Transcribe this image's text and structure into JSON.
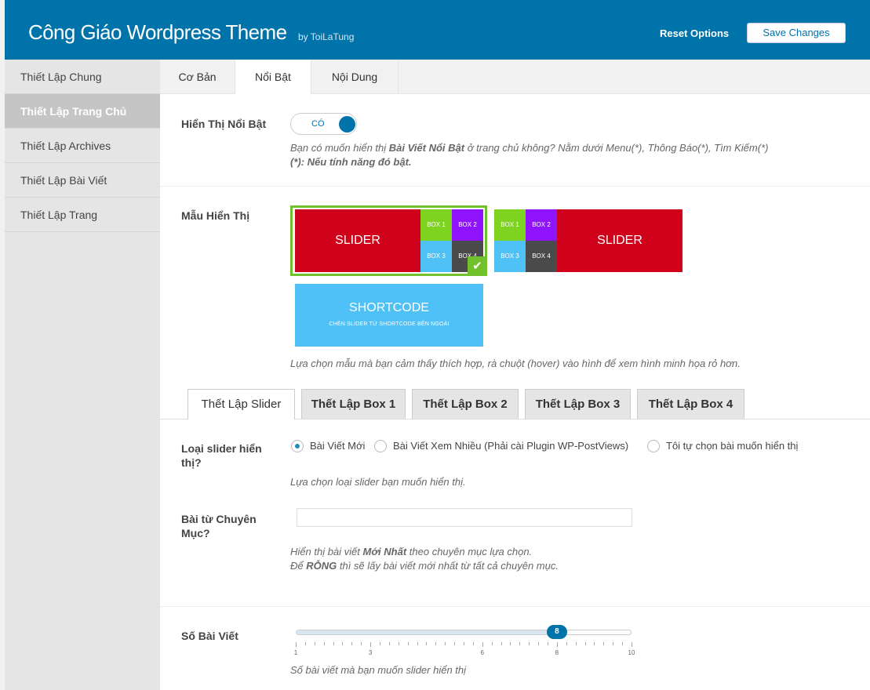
{
  "header": {
    "title": "Công Giáo Wordpress Theme",
    "by": "by ToiLaTung",
    "reset_label": "Reset Options",
    "save_label": "Save Changes",
    "bg_color": "#0073aa"
  },
  "sidebar": {
    "items": [
      {
        "label": "Thiết Lập Chung",
        "active": false
      },
      {
        "label": "Thiết Lập Trang Chủ",
        "active": true
      },
      {
        "label": "Thiết Lập Archives",
        "active": false
      },
      {
        "label": "Thiết Lập Bài Viết",
        "active": false
      },
      {
        "label": "Thiết Lập Trang",
        "active": false
      }
    ]
  },
  "tabs": [
    {
      "label": "Cơ Bản",
      "active": false
    },
    {
      "label": "Nổi Bật",
      "active": true
    },
    {
      "label": "Nội Dung",
      "active": false
    }
  ],
  "featured": {
    "label": "Hiển Thị Nổi Bật",
    "toggle_text": "CÓ",
    "toggle_on": true,
    "desc_1_a": "Bạn có muốn hiển thị ",
    "desc_1_b": "Bài Viết Nổi Bật",
    "desc_1_c": " ở trang chủ không? Nằm dưới Menu(*), Thông Báo(*), Tìm Kiếm(*)",
    "desc_2": "(*): Nếu tính năng đó bật."
  },
  "layout": {
    "label": "Mẫu Hiển Thị",
    "slider_text": "SLIDER",
    "boxes": [
      "BOX 1",
      "BOX 2",
      "BOX 3",
      "BOX 4"
    ],
    "box_colors": [
      "#7ed321",
      "#9013fe",
      "#4fc1f6",
      "#4a4a4a"
    ],
    "slider_color": "#d0021b",
    "shortcode_title": "SHORTCODE",
    "shortcode_sub": "CHÈN SLIDER TỪ SHORTCODE BÊN NGOÀI",
    "selected_index": 0,
    "desc": "Lựa chọn mẫu mà bạn cảm thấy thích hợp, rà chuột (hover) vào hình để xem hình minh họa rỏ hơn."
  },
  "subtabs": [
    {
      "label": "Thết Lập Slider",
      "active": true
    },
    {
      "label": "Thết Lập Box 1",
      "active": false
    },
    {
      "label": "Thết Lập Box 2",
      "active": false
    },
    {
      "label": "Thết Lập Box 3",
      "active": false
    },
    {
      "label": "Thết Lập Box 4",
      "active": false
    }
  ],
  "slider_type": {
    "label_1": "Loại slider hiển",
    "label_2": "thị?",
    "options": [
      {
        "label": "Bài Viết Mới",
        "checked": true
      },
      {
        "label": "Bài Viết Xem Nhiều (Phải cài Plugin WP-PostViews)",
        "checked": false
      },
      {
        "label": "Tôi tự chọn bài muốn hiển thị",
        "checked": false
      }
    ],
    "desc": "Lựa chọn loại slider bạn muốn hiển thị."
  },
  "category": {
    "label_1": "Bài từ Chuyên",
    "label_2": "Mục?",
    "value": "",
    "desc_1_a": "Hiển thị bài viết ",
    "desc_1_b": "Mới Nhất",
    "desc_1_c": " theo chuyên mục lựa chọn.",
    "desc_2_a": "Để ",
    "desc_2_b": "RỖNG",
    "desc_2_c": " thì sẽ lấy bài viết mới nhất từ tất cả chuyên mục."
  },
  "post_count": {
    "label": "Số Bài Viết",
    "value": 8,
    "min": 1,
    "max": 10,
    "tick_labels": [
      "1",
      "3",
      "6",
      "8",
      "10"
    ],
    "desc": "Số bài viết mà bạn muốn slider hiển thị"
  }
}
